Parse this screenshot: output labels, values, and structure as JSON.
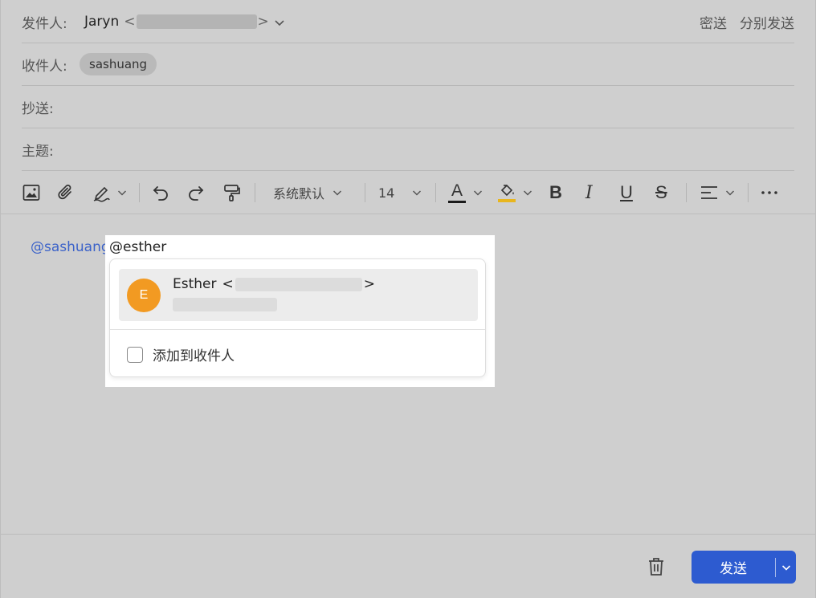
{
  "header": {
    "from_label": "发件人:",
    "sender_name": "Jaryn",
    "open_angle": "<",
    "close_angle": ">",
    "bcc_link": "密送",
    "separate_send_link": "分别发送",
    "to_label": "收件人:",
    "recipient_chip": "sashuang",
    "cc_label": "抄送:",
    "subject_label": "主题:"
  },
  "toolbar": {
    "font_family": "系统默认",
    "font_size": "14",
    "bold": "B",
    "italic": "I",
    "underline": "U",
    "strike": "S",
    "font_color_letter": "A",
    "font_color": "#1a1a1a",
    "highlight_color": "#e8b61e"
  },
  "editor": {
    "mention_text": "@sashuang",
    "typed_text": "@esther"
  },
  "mention_popup": {
    "avatar_initial": "E",
    "avatar_color": "#f29a22",
    "contact_name": "Esther",
    "open_angle": "<",
    "close_angle": ">",
    "add_to_recipients_label": "添加到收件人"
  },
  "footer": {
    "send_label": "发送",
    "send_color": "#2d5bd0"
  }
}
